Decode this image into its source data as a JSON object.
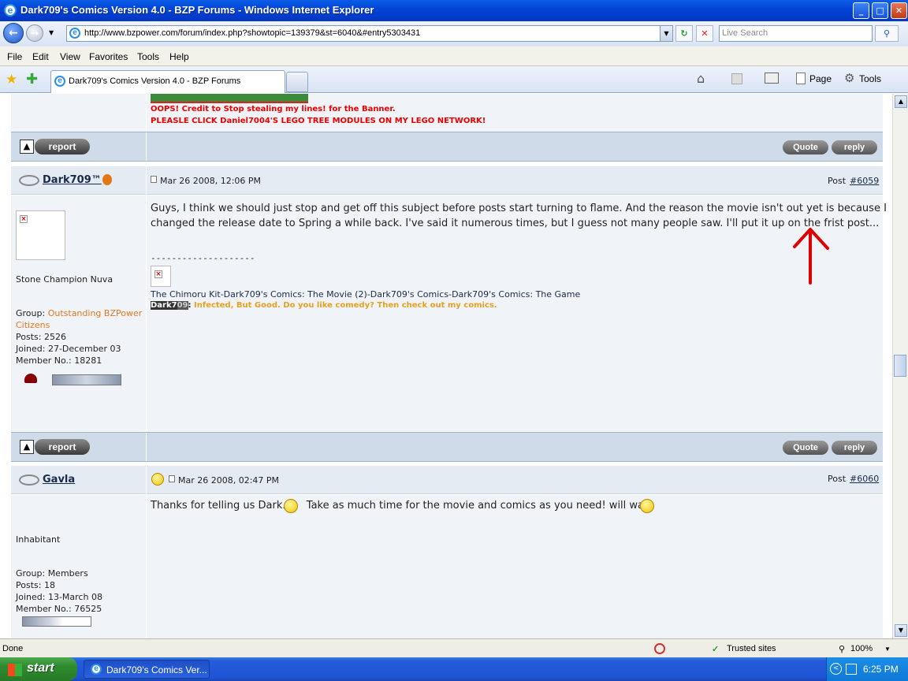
{
  "window": {
    "title": "Dark709's Comics Version 4.0 - BZP Forums - Windows Internet Explorer",
    "min": "_",
    "max": "□",
    "close": "✕"
  },
  "nav": {
    "back": "←",
    "forward": "→",
    "url": "http://www.bzpower.com/forum/index.php?showtopic=139379&st=6040&#entry5303431",
    "search_placeholder": "Live Search",
    "refresh": "↻",
    "stop": "✕",
    "search_go": "⚲"
  },
  "menu": [
    "File",
    "Edit",
    "View",
    "Favorites",
    "Tools",
    "Help"
  ],
  "tabs": {
    "active_label": "Dark709's Comics Version 4.0 - BZP Forums",
    "page_label": "Page",
    "tools_label": "Tools"
  },
  "banner_text": {
    "line1": "OOPS! Credit to Stop stealing my lines! for the Banner.",
    "line2": "PLEASLE CLICK Daniel7004'S LEGO TREE MODULES ON MY LEGO NETWORK!"
  },
  "buttons": {
    "report": "report",
    "quote": "Quote",
    "reply": "reply",
    "top": "▲"
  },
  "posts": [
    {
      "user": "Dark709™",
      "date": "Mar 26 2008, 12:06 PM",
      "post_label": "Post",
      "post_number": "#6059",
      "rank": "Stone Champion Nuva",
      "group_label": "Group:",
      "group_value": "Outstanding BZPower",
      "group_value2": "Citizens",
      "posts_line": "Posts: 2526",
      "joined_line": "Joined: 27-December 03",
      "member_line": "Member No.: 18281",
      "body_line1": "Guys, I think we should just stop and get off this subject before posts start turning to flame. And the reason the movie isn't out yet is because I",
      "body_line2": "changed the release date to Spring a while back. I've said it numerous times, but I guess not many people saw. I'll put it up on the frist post...",
      "sig_divider": "--------------------",
      "sig_link1": "The Chimoru Kit",
      "sig_link2": "Dark709's Comics: The Movie",
      "sig_link3": "2",
      "sig_link4": "Dark709's Comics",
      "sig_link5": "Dark709's Comics: The Game",
      "sig_tag_a": "Dark7",
      "sig_tag_b": "09",
      "sig_colored": "Infected, But Good. Do you like comedy? Then check out my comics."
    },
    {
      "user": "Gavla",
      "date": "Mar 26 2008, 02:47 PM",
      "post_label": "Post",
      "post_number": "#6060",
      "rank": "Inhabitant",
      "group_line": "Group: Members",
      "posts_line": "Posts: 18",
      "joined_line": "Joined: 13-March 08",
      "member_line": "Member No.: 76525",
      "body_a": "Thanks for telling us Dark.",
      "body_b": "Take as much time for the movie and comics as you need! will wait."
    }
  ],
  "status": {
    "left": "Done",
    "zone": "Trusted sites",
    "zoom": "100%"
  },
  "taskbar": {
    "start": "start",
    "item": "Dark709's Comics Ver...",
    "clock": "6:25 PM"
  },
  "colors": {
    "annotation_arrow": "#e00000",
    "banner_red": "#e00000",
    "group_orange": "#e6781a"
  }
}
